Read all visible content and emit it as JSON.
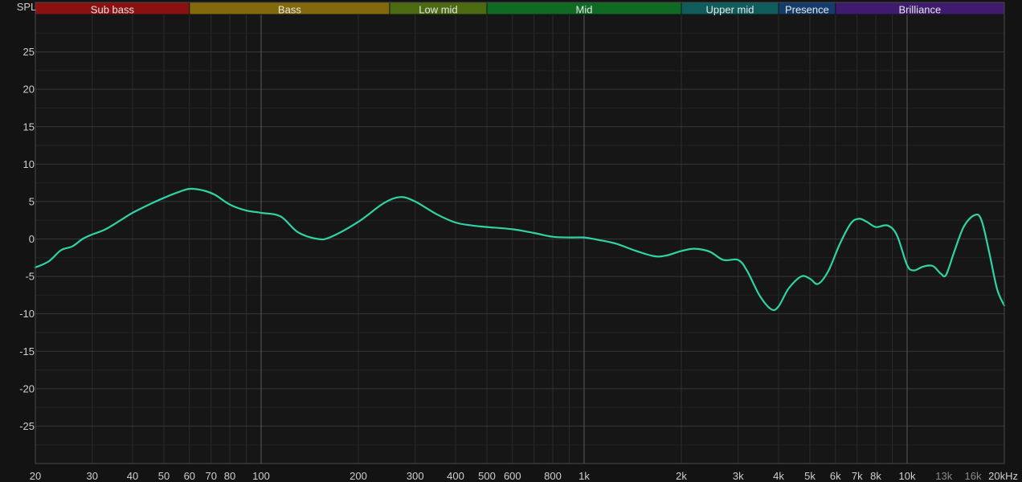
{
  "chart_data": {
    "type": "line",
    "ylabel": "SPL",
    "xunit": "Hz",
    "xscale": "log",
    "xlim": [
      20,
      20000
    ],
    "ylim": [
      -30,
      30
    ],
    "grid": true,
    "yticks": [
      {
        "value": 25,
        "label": "25"
      },
      {
        "value": 20,
        "label": "20"
      },
      {
        "value": 15,
        "label": "15"
      },
      {
        "value": 10,
        "label": "10"
      },
      {
        "value": 5,
        "label": "5"
      },
      {
        "value": 0,
        "label": "0"
      },
      {
        "value": -5,
        "label": "-5"
      },
      {
        "value": -10,
        "label": "-10"
      },
      {
        "value": -15,
        "label": "-15"
      },
      {
        "value": -20,
        "label": "-20"
      },
      {
        "value": -25,
        "label": "-25"
      }
    ],
    "xticks": [
      {
        "value": 20,
        "label": "20"
      },
      {
        "value": 30,
        "label": "30"
      },
      {
        "value": 40,
        "label": "40"
      },
      {
        "value": 50,
        "label": "50"
      },
      {
        "value": 60,
        "label": "60"
      },
      {
        "value": 70,
        "label": "70"
      },
      {
        "value": 80,
        "label": "80"
      },
      {
        "value": 100,
        "label": "100"
      },
      {
        "value": 200,
        "label": "200"
      },
      {
        "value": 300,
        "label": "300"
      },
      {
        "value": 400,
        "label": "400"
      },
      {
        "value": 500,
        "label": "500"
      },
      {
        "value": 600,
        "label": "600"
      },
      {
        "value": 800,
        "label": "800"
      },
      {
        "value": 1000,
        "label": "1k"
      },
      {
        "value": 2000,
        "label": "2k"
      },
      {
        "value": 3000,
        "label": "3k"
      },
      {
        "value": 4000,
        "label": "4k"
      },
      {
        "value": 5000,
        "label": "5k"
      },
      {
        "value": 6000,
        "label": "6k"
      },
      {
        "value": 7000,
        "label": "7k"
      },
      {
        "value": 8000,
        "label": "8k"
      },
      {
        "value": 10000,
        "label": "10k"
      },
      {
        "value": 13000,
        "label": "13k",
        "dim": true
      },
      {
        "value": 16000,
        "label": "16k",
        "dim": true
      },
      {
        "value": 20000,
        "label": "20kHz"
      }
    ],
    "bands": [
      {
        "name": "Sub bass",
        "from": 20,
        "to": 60,
        "color": "#8b1010"
      },
      {
        "name": "Bass",
        "from": 60,
        "to": 250,
        "color": "#826a0c"
      },
      {
        "name": "Low mid",
        "from": 250,
        "to": 500,
        "color": "#4c6b10"
      },
      {
        "name": "Mid",
        "from": 500,
        "to": 2000,
        "color": "#0f6b24"
      },
      {
        "name": "Upper mid",
        "from": 2000,
        "to": 4000,
        "color": "#0f5c5c"
      },
      {
        "name": "Presence",
        "from": 4000,
        "to": 6000,
        "color": "#133b6b"
      },
      {
        "name": "Brilliance",
        "from": 6000,
        "to": 20000,
        "color": "#3f1a6e"
      }
    ],
    "series": [
      {
        "color": "#2fd3a4",
        "points": [
          [
            20,
            -3.8
          ],
          [
            22,
            -3.0
          ],
          [
            24,
            -1.5
          ],
          [
            26,
            -1.0
          ],
          [
            28,
            0.0
          ],
          [
            30,
            0.6
          ],
          [
            33,
            1.3
          ],
          [
            37,
            2.6
          ],
          [
            40,
            3.5
          ],
          [
            45,
            4.6
          ],
          [
            50,
            5.5
          ],
          [
            55,
            6.2
          ],
          [
            60,
            6.7
          ],
          [
            66,
            6.5
          ],
          [
            72,
            5.9
          ],
          [
            80,
            4.6
          ],
          [
            90,
            3.8
          ],
          [
            100,
            3.5
          ],
          [
            115,
            3.0
          ],
          [
            130,
            0.9
          ],
          [
            150,
            0.0
          ],
          [
            165,
            0.3
          ],
          [
            200,
            2.3
          ],
          [
            240,
            4.8
          ],
          [
            270,
            5.6
          ],
          [
            300,
            5.0
          ],
          [
            350,
            3.3
          ],
          [
            400,
            2.2
          ],
          [
            450,
            1.8
          ],
          [
            500,
            1.6
          ],
          [
            600,
            1.3
          ],
          [
            700,
            0.8
          ],
          [
            800,
            0.3
          ],
          [
            900,
            0.2
          ],
          [
            1000,
            0.2
          ],
          [
            1100,
            -0.1
          ],
          [
            1250,
            -0.6
          ],
          [
            1450,
            -1.6
          ],
          [
            1650,
            -2.3
          ],
          [
            1800,
            -2.2
          ],
          [
            2000,
            -1.6
          ],
          [
            2200,
            -1.3
          ],
          [
            2450,
            -1.7
          ],
          [
            2700,
            -2.8
          ],
          [
            3000,
            -2.8
          ],
          [
            3200,
            -4.3
          ],
          [
            3500,
            -7.6
          ],
          [
            3800,
            -9.4
          ],
          [
            4000,
            -9.0
          ],
          [
            4300,
            -6.6
          ],
          [
            4700,
            -5.0
          ],
          [
            5000,
            -5.3
          ],
          [
            5300,
            -6.0
          ],
          [
            5700,
            -4.3
          ],
          [
            6200,
            -0.6
          ],
          [
            6700,
            2.1
          ],
          [
            7100,
            2.7
          ],
          [
            7500,
            2.3
          ],
          [
            8000,
            1.6
          ],
          [
            8700,
            1.8
          ],
          [
            9300,
            0.5
          ],
          [
            10000,
            -3.5
          ],
          [
            10500,
            -4.2
          ],
          [
            11200,
            -3.7
          ],
          [
            12000,
            -3.6
          ],
          [
            12700,
            -4.6
          ],
          [
            13200,
            -4.8
          ],
          [
            14000,
            -1.7
          ],
          [
            15000,
            1.7
          ],
          [
            16200,
            3.2
          ],
          [
            17000,
            2.5
          ],
          [
            18000,
            -2.0
          ],
          [
            19000,
            -6.7
          ],
          [
            20000,
            -8.9
          ]
        ]
      }
    ]
  }
}
